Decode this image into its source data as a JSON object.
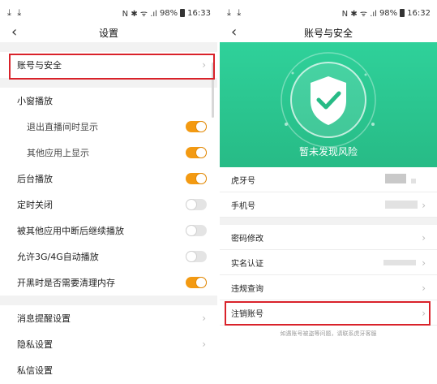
{
  "status_left": {
    "download_icons": "⤓ ⤓",
    "indicators": "N ✱ ᯤ .ıl",
    "battery": "98%",
    "time": "16:33"
  },
  "status_right": {
    "download_icons": "⤓ ⤓",
    "indicators": "N ✱ ᯤ .ıl",
    "battery": "98%",
    "time": "16:32"
  },
  "settings": {
    "title": "设置",
    "back_icon": "‹",
    "account_security": "账号与安全",
    "mini_window_header": "小窗播放",
    "exit_live_show": "退出直播间时显示",
    "other_app_show": "其他应用上显示",
    "background_play": "后台播放",
    "timer_close": "定时关闭",
    "resume_after_interrupt": "被其他应用中断后继续播放",
    "allow_3g4g": "允许3G/4G自动播放",
    "clear_memory_on_game": "开黑时是否需要清理内存",
    "message_notify": "消息提醒设置",
    "privacy": "隐私设置",
    "private_msg": "私信设置",
    "toggles": {
      "exit_live_show": true,
      "other_app_show": true,
      "background_play": true,
      "timer_close": false,
      "resume_after_interrupt": false,
      "allow_3g4g": false,
      "clear_memory_on_game": true
    }
  },
  "account": {
    "title": "账号与安全",
    "back_icon": "‹",
    "risk_status": "暂未发现风险",
    "huya_id": "虎牙号",
    "phone": "手机号",
    "change_password": "密码修改",
    "real_name": "实名认证",
    "violation_query": "违规查询",
    "cancel_account": "注销账号",
    "footnote": "如遇账号被盗等问题，请联系虎牙客服"
  },
  "colors": {
    "accent_orange": "#f39a12",
    "banner_green": "#2fd19a",
    "highlight_red": "#d9222a",
    "section_gray": "#f2f2f2"
  },
  "icons": {
    "chevron": "›",
    "shield": "shield-check-icon"
  }
}
